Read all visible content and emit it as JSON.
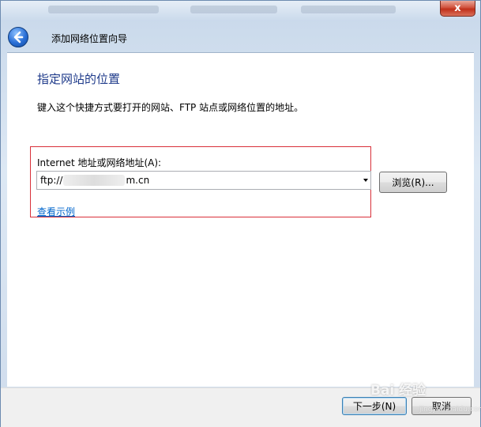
{
  "window": {
    "close_label": "x"
  },
  "wizard": {
    "title": "添加网络位置向导"
  },
  "page": {
    "heading": "指定网站的位置",
    "description": "键入这个快捷方式要打开的网站、FTP 站点或网络位置的地址。"
  },
  "address": {
    "label": "Internet 地址或网络地址(A):",
    "value_prefix": "ftp://",
    "value_suffix": "m.cn",
    "browse_label": "浏览(R)...",
    "example_link": "查看示例"
  },
  "footer": {
    "next_label": "下一步(N)",
    "cancel_label": "取消"
  },
  "watermark": {
    "text": "Bai 经验",
    "sub": "jingyan.baidu.com"
  },
  "icons": {
    "back": "back-arrow-icon",
    "dropdown": "chevron-down-icon",
    "close": "close-icon"
  },
  "colors": {
    "heading": "#1e3a8a",
    "link": "#0066cc",
    "highlight_border": "#d9303a",
    "close_button": "#c0301a"
  }
}
